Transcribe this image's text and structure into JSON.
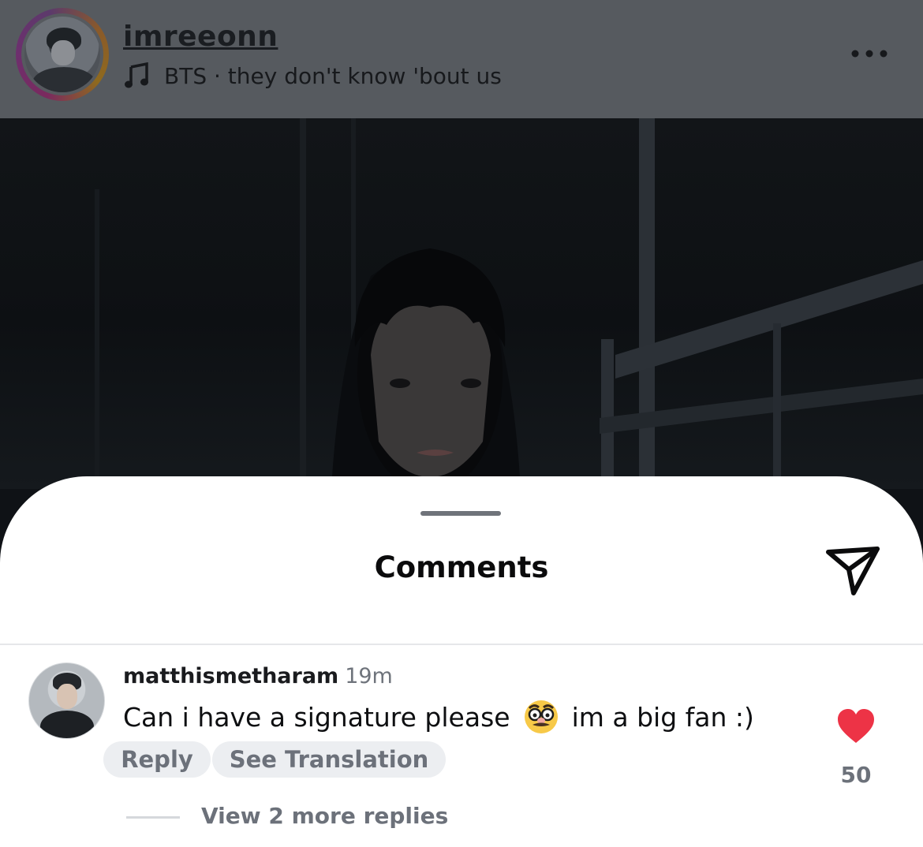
{
  "post": {
    "username": "imreeonn",
    "music": {
      "icon": "music-note-icon",
      "text": "BTS · they don't know 'bout us"
    },
    "more_icon": "more-horizontal-icon"
  },
  "comments_sheet": {
    "title": "Comments",
    "share_icon": "send-icon",
    "comment": {
      "username": "matthismetharam",
      "time": "19m",
      "text_before_emoji": "Can i have a signature please",
      "emoji": "disguised-face-emoji",
      "text_after_emoji": "im a big fan :)",
      "reply_label": "Reply",
      "translate_label": "See Translation",
      "likes": "50",
      "liked": true,
      "heart_color": "#ed3346"
    },
    "view_replies_label": "View 2 more replies"
  },
  "colors": {
    "header_dim": "#565a5f",
    "secondary_text": "#6c717a",
    "pill_bg": "#eceef1"
  }
}
